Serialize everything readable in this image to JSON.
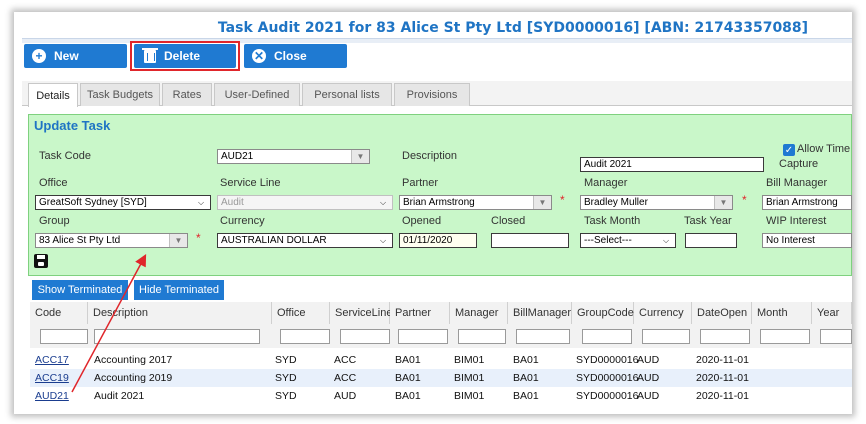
{
  "window": {
    "title": "Task Audit 2021 for 83 Alice St Pty Ltd [SYD0000016] [ABN: 21743357088]"
  },
  "toolbar": {
    "new_label": "New",
    "delete_label": "Delete",
    "close_label": "Close"
  },
  "tabs": [
    "Details",
    "Task Budgets",
    "Rates",
    "User-Defined",
    "Personal lists",
    "Provisions"
  ],
  "form": {
    "title": "Update Task",
    "task_code_label": "Task Code",
    "task_code_value": "AUD21",
    "description_label": "Description",
    "description_value": "Audit 2021",
    "allow_time_label_1": "Allow Time",
    "allow_time_label_2": "Capture",
    "office_label": "Office",
    "office_value": "GreatSoft Sydney [SYD]",
    "service_line_label": "Service Line",
    "service_line_value": "Audit",
    "partner_label": "Partner",
    "partner_value": "Brian Armstrong",
    "manager_label": "Manager",
    "manager_value": "Bradley Muller",
    "bill_manager_label": "Bill Manager",
    "bill_manager_value": "Brian Armstrong",
    "group_label": "Group",
    "group_value": "83 Alice St Pty Ltd",
    "currency_label": "Currency",
    "currency_value": "AUSTRALIAN DOLLAR",
    "opened_label": "Opened",
    "opened_value": "01/11/2020",
    "closed_label": "Closed",
    "closed_value": "",
    "task_month_label": "Task Month",
    "task_month_value": "---Select---",
    "task_year_label": "Task Year",
    "task_year_value": "",
    "wip_interest_label": "WIP Interest",
    "wip_interest_value": "No Interest",
    "required_mark": "*"
  },
  "grid_buttons": {
    "show_terminated": "Show Terminated",
    "hide_terminated": "Hide Terminated"
  },
  "grid": {
    "columns": [
      "Code",
      "Description",
      "Office",
      "ServiceLine",
      "Partner",
      "Manager",
      "BillManager",
      "GroupCode",
      "Currency",
      "DateOpen",
      "Month",
      "Year"
    ],
    "rows": [
      [
        "ACC17",
        "Accounting 2017",
        "SYD",
        "ACC",
        "BA01",
        "BIM01",
        "BA01",
        "SYD0000016",
        "AUD",
        "2020-11-01"
      ],
      [
        "ACC19",
        "Accounting 2019",
        "SYD",
        "ACC",
        "BA01",
        "BIM01",
        "BA01",
        "SYD0000016",
        "AUD",
        "2020-11-01"
      ],
      [
        "AUD21",
        "Audit 2021",
        "SYD",
        "AUD",
        "BA01",
        "BIM01",
        "BA01",
        "SYD0000016",
        "AUD",
        "2020-11-01"
      ]
    ]
  },
  "colors": {
    "accent": "#1f7ad2",
    "highlight": "#e0262b",
    "panel": "#c9f7c9"
  }
}
